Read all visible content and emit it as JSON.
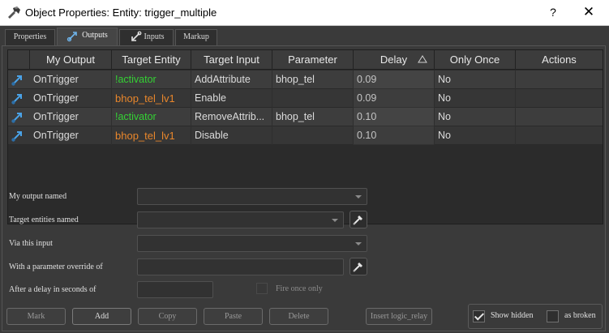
{
  "window": {
    "title": "Object Properties: Entity: trigger_multiple",
    "help_label": "?",
    "close_label": "✕"
  },
  "tabs": [
    {
      "label": "Properties",
      "active": false
    },
    {
      "label": "Outputs",
      "active": true
    },
    {
      "label": "Inputs",
      "active": false
    },
    {
      "label": "Markup",
      "active": false
    }
  ],
  "table": {
    "columns": [
      "My Output",
      "Target Entity",
      "Target Input",
      "Parameter",
      "Delay",
      "Only Once",
      "Actions"
    ],
    "sort_column": "Delay",
    "rows": [
      {
        "output": "OnTrigger",
        "target": "!activator",
        "target_color": "green",
        "input": "AddAttribute",
        "parameter": "bhop_tel",
        "delay": "0.09",
        "once": "No"
      },
      {
        "output": "OnTrigger",
        "target": "bhop_tel_lv1",
        "target_color": "orange",
        "input": "Enable",
        "parameter": "",
        "delay": "0.09",
        "once": "No"
      },
      {
        "output": "OnTrigger",
        "target": "!activator",
        "target_color": "green",
        "input": "RemoveAttrib...",
        "parameter": "bhop_tel",
        "delay": "0.10",
        "once": "No"
      },
      {
        "output": "OnTrigger",
        "target": "bhop_tel_lv1",
        "target_color": "orange",
        "input": "Disable",
        "parameter": "",
        "delay": "0.10",
        "once": "No"
      }
    ]
  },
  "form": {
    "output_named_label": "My output named",
    "target_entities_label": "Target entities named",
    "via_input_label": "Via this input",
    "param_override_label": "With a parameter override of",
    "delay_label": "After a delay in seconds of",
    "fire_once_label": "Fire once only"
  },
  "buttons": {
    "mark": "Mark",
    "add": "Add",
    "copy": "Copy",
    "paste": "Paste",
    "delete": "Delete",
    "insert": "Insert logic_relay"
  },
  "options": {
    "show_hidden_label": "Show hidden",
    "show_hidden_checked": true,
    "as_broken_label": "as broken",
    "as_broken_checked": false
  },
  "colors": {
    "green_target": "#34d134",
    "orange_target": "#e8862b",
    "output_icon": "#4aa3e8"
  }
}
